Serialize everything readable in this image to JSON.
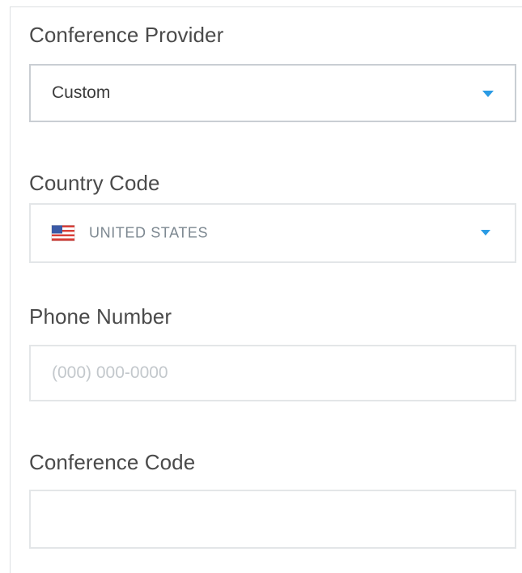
{
  "form": {
    "conference_provider": {
      "label": "Conference Provider",
      "selected_value": "Custom"
    },
    "country_code": {
      "label": "Country Code",
      "selected_value": "UNITED STATES",
      "flag_icon": "us-flag-icon"
    },
    "phone_number": {
      "label": "Phone Number",
      "value": "",
      "placeholder": "(000) 000-0000"
    },
    "conference_code": {
      "label": "Conference Code",
      "value": "",
      "placeholder": ""
    }
  },
  "colors": {
    "accent": "#2b9be4",
    "border": "#e3e6e8",
    "label": "#4a4a4a",
    "placeholder": "#c3c8cc"
  }
}
